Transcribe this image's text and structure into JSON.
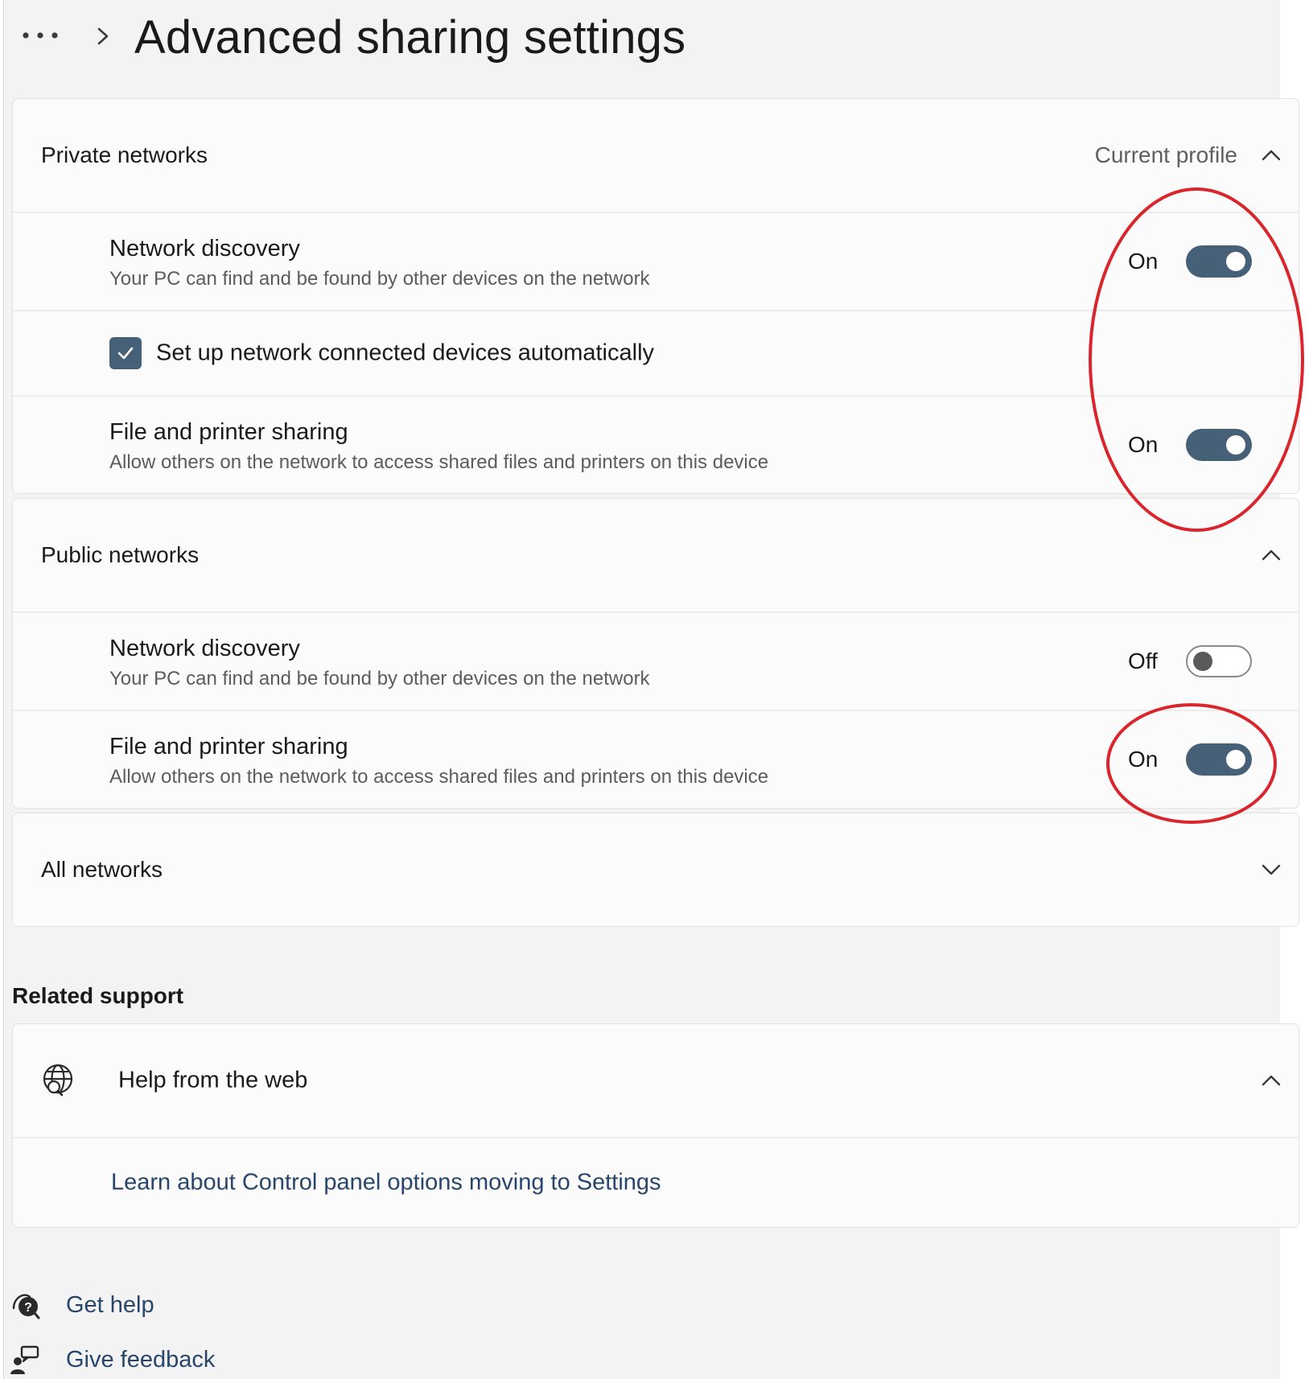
{
  "header": {
    "more_label": "More",
    "title": "Advanced sharing settings"
  },
  "private": {
    "label": "Private networks",
    "profile": "Current profile",
    "discovery": {
      "title": "Network discovery",
      "desc": "Your PC can find and be found by other devices on the network",
      "state": "On"
    },
    "auto_setup": {
      "label": "Set up network connected devices automatically",
      "checked": true
    },
    "sharing": {
      "title": "File and printer sharing",
      "desc": "Allow others on the network to access shared files and printers on this device",
      "state": "On"
    }
  },
  "public": {
    "label": "Public networks",
    "discovery": {
      "title": "Network discovery",
      "desc": "Your PC can find and be found by other devices on the network",
      "state": "Off"
    },
    "sharing": {
      "title": "File and printer sharing",
      "desc": "Allow others on the network to access shared files and printers on this device",
      "state": "On"
    }
  },
  "all": {
    "label": "All networks"
  },
  "related": {
    "heading": "Related support",
    "help_web": "Help from the web",
    "link": "Learn about Control panel options moving to Settings"
  },
  "footer": {
    "get_help": "Get help",
    "give_feedback": "Give feedback"
  },
  "colors": {
    "accent": "#466078",
    "link": "#28466b",
    "annotation": "#d9262c"
  },
  "icons": [
    "more-icon",
    "chevron-right-icon",
    "chevron-up-icon",
    "chevron-down-icon",
    "checkmark-icon",
    "globe-search-icon",
    "get-help-icon",
    "feedback-icon"
  ]
}
